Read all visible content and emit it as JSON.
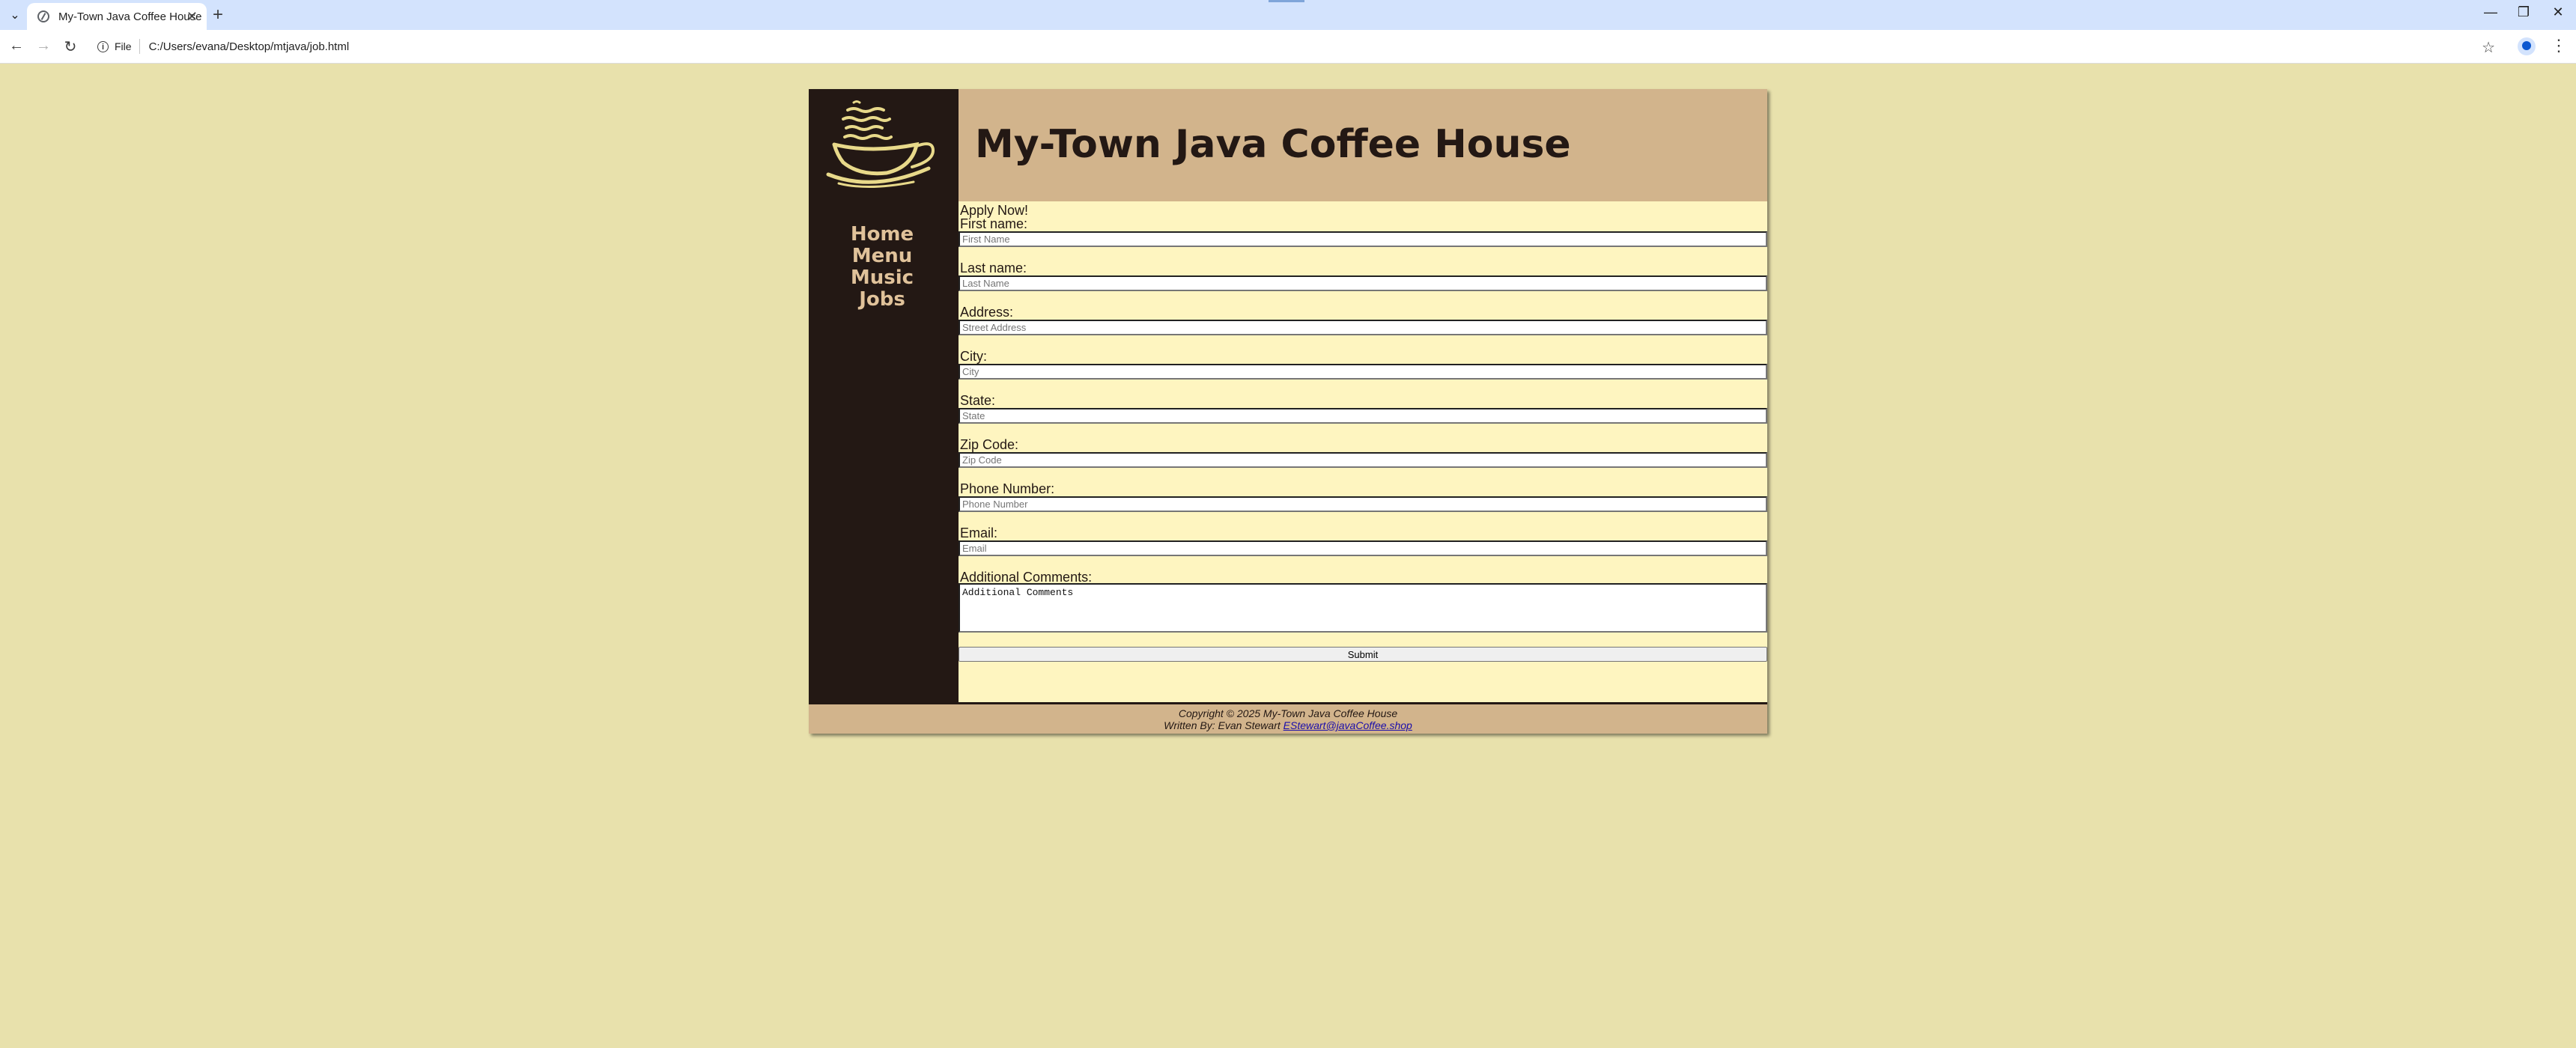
{
  "browser": {
    "tab_title": "My-Town Java Coffee House",
    "url_scheme_label": "File",
    "url": "C:/Users/evana/Desktop/mtjava/job.html"
  },
  "site": {
    "title": "My-Town Java Coffee House",
    "nav": [
      "Home",
      "Menu",
      "Music",
      "Jobs"
    ]
  },
  "form": {
    "intro": "Apply Now!",
    "fields": [
      {
        "label": "First name:",
        "placeholder": "First Name"
      },
      {
        "label": "Last name:",
        "placeholder": "Last Name"
      },
      {
        "label": "Address:",
        "placeholder": "Street Address"
      },
      {
        "label": "City:",
        "placeholder": "City"
      },
      {
        "label": "State:",
        "placeholder": "State"
      },
      {
        "label": "Zip Code:",
        "placeholder": "Zip Code"
      },
      {
        "label": "Phone Number:",
        "placeholder": "Phone Number"
      },
      {
        "label": "Email:",
        "placeholder": "Email"
      }
    ],
    "comments_label": "Additional Comments:",
    "comments_value": "Additional Comments",
    "submit_label": "Submit"
  },
  "footer": {
    "copyright": "Copyright © 2025 My-Town Java Coffee House",
    "written_by": "Written By: Evan Stewart",
    "email": "EStewart@javaCoffee.shop"
  },
  "colors": {
    "page_bg": "#e8e1ac",
    "header_bg": "#d2b48c",
    "sidebar_bg": "#231814",
    "content_bg": "#fef5c0",
    "nav_text": "#e0c29a"
  }
}
